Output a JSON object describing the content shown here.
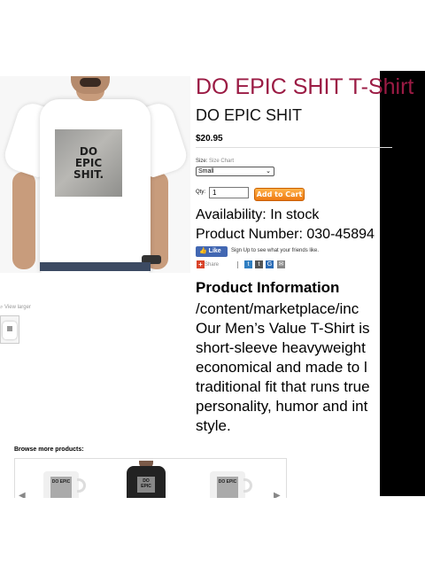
{
  "product": {
    "title": "DO EPIC SHIT T-Shirt",
    "design_name": "DO EPIC SHIT",
    "price": "$20.95",
    "print_lines": [
      "DO",
      "EPIC",
      "SHIT."
    ],
    "colors": {
      "title": "#9b1b44",
      "cart_button": "#ee7a12",
      "facebook": "#4267b2"
    }
  },
  "options": {
    "size_label": "Size:",
    "size_chart_link": "Size Chart",
    "size_selected": "Small",
    "qty_label": "Qty:",
    "qty_value": "1",
    "add_to_cart_label": "Add to Cart"
  },
  "stock": {
    "availability": "Availability: In stock",
    "product_number": "Product Number: 030-45894"
  },
  "social": {
    "like_label": "Like",
    "like_prompt": "Sign Up to see what your friends like.",
    "share_label": "Share",
    "icons": [
      "twitter-icon",
      "tumblr-icon",
      "google-icon",
      "email-icon"
    ]
  },
  "info": {
    "heading": "Product Information",
    "lines": [
      "/content/marketplace/inc",
      "Our Men’s Value T-Shirt is",
      "short-sleeve heavyweight",
      "economical and made to l",
      "traditional fit that runs true",
      "personality, humor and int",
      "style."
    ]
  },
  "gallery": {
    "view_larger_label": "View larger"
  },
  "browse": {
    "label": "Browse more products:",
    "items": [
      {
        "print": "DO EPIC"
      },
      {
        "print": "DO EPIC"
      },
      {
        "print": "DO EPIC"
      }
    ]
  }
}
